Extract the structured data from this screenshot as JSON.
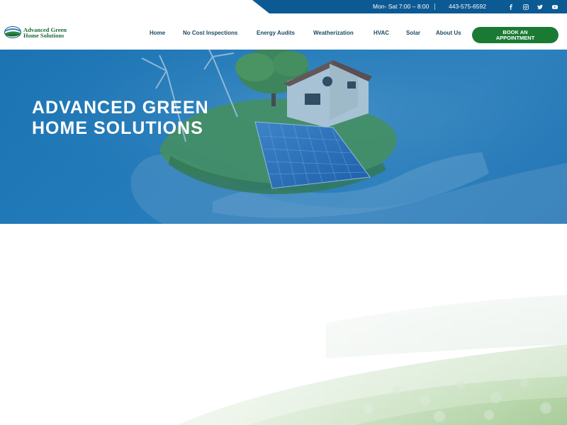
{
  "topbar": {
    "hours": "Mon- Sat 7:00 – 8:00",
    "phone": "443-575-6592",
    "social": [
      "facebook-icon",
      "instagram-icon",
      "twitter-icon",
      "youtube-icon"
    ],
    "background_color": "#0c5a93"
  },
  "header": {
    "logo_line1": "Advanced Green",
    "logo_line2": "Home Solutions",
    "nav": {
      "home": "Home",
      "no_cost_inspections": "No Cost Inspections",
      "energy_audits": "Energy Audits",
      "weatherization": "Weatherization",
      "hvac": "HVAC",
      "solar": "Solar",
      "about_us": "About Us"
    },
    "book_line1": "BOOK AN",
    "book_line2": "APPOINTMENT",
    "accent_color": "#1a7a34"
  },
  "hero": {
    "title_line1": "ADVANCED GREEN",
    "title_line2": "HOME SOLUTIONS",
    "overlay_color": "#1c76b5"
  }
}
